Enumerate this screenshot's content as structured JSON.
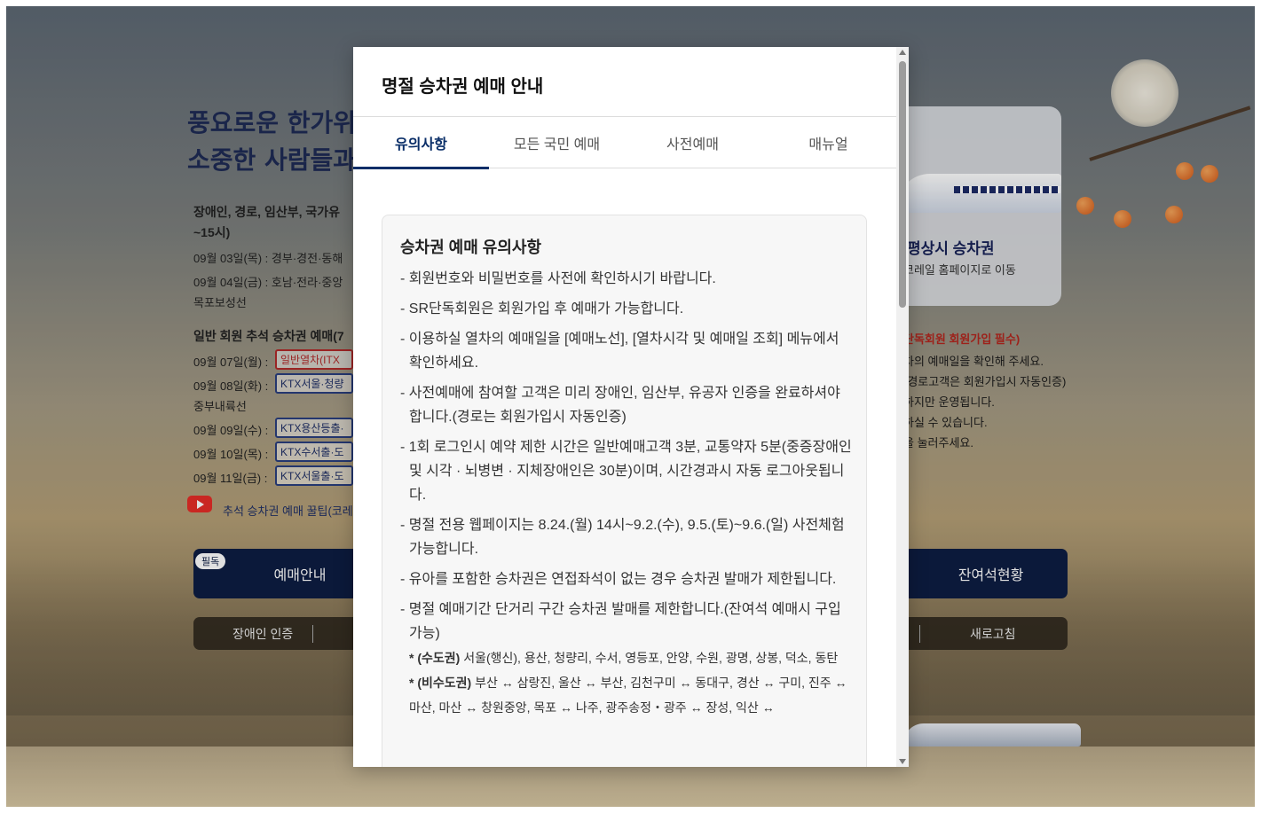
{
  "background": {
    "headline": "풍요로운 한가위\n소중한 사람들과",
    "intro": "장애인, 경로, 임산부, 국가유",
    "intro_time": "~15시)",
    "schedule_1": "09월 03일(목) : 경부·경전·동해",
    "schedule_2": "09월 04일(금) : 호남·전라·중앙",
    "schedule_2b": "목포보성선",
    "general_title": "일반 회원 추석 승차권 예매(7",
    "general_1_date": "09월 07일(월) :",
    "general_1_tag": "일반열차(ITX",
    "general_2_date": "09월 08일(화) :",
    "general_2_tag": "KTX서울·청량",
    "general_2b": "중부내륙선",
    "general_3_date": "09월 09일(수) :",
    "general_3_tag": "KTX용산등출·",
    "general_4_date": "09월 10일(목) :",
    "general_4_tag": "KTX수서출·도",
    "general_5_date": "09월 11일(금) :",
    "general_5_tag": "KTX서울출·도",
    "youtube_link": "추석 승차권 예매 꿀팁(코레",
    "card_title": "평상시 승차권",
    "card_sub": "코레일 홈페이지로 이동",
    "side_red": "단독회원 회원가입 필수)",
    "side_1": "차의 예매일을 확인해 주세요.",
    "side_2": "(경로고객은 회원가입시 자동인증)",
    "side_3": "하지만 운영됩니다.",
    "side_4": "하실 수 있습니다.",
    "side_5": "을 눌러주세요.",
    "btn_booking_badge": "필독",
    "btn_booking": "예매안내",
    "btn_seats": "잔여석현황",
    "btn_disabled_auth": "장애인 인증",
    "btn_refresh": "새로고침"
  },
  "modal": {
    "title": "명절 승차권 예매 안내",
    "tabs": [
      {
        "label": "유의사항",
        "active": true
      },
      {
        "label": "모든 국민 예매",
        "active": false
      },
      {
        "label": "사전예매",
        "active": false
      },
      {
        "label": "매뉴얼",
        "active": false
      }
    ],
    "notice": {
      "title": "승차권 예매 유의사항",
      "items": [
        "- 회원번호와 비밀번호를 사전에 확인하시기 바랍니다.",
        "- SR단독회원은 회원가입 후 예매가 가능합니다.",
        "- 이용하실 열차의 예매일을 [예매노선], [열차시각 및 예매일 조회] 메뉴에서 확인하세요.",
        "- 사전예매에 참여할 고객은 미리 장애인, 임산부, 유공자 인증을 완료하셔야 합니다.(경로는 회원가입시 자동인증)",
        "- 1회 로그인시 예약 제한 시간은 일반예매고객 3분, 교통약자 5분(중증장애인 및 시각 · 뇌병변 · 지체장애인은 30분)이며, 시간경과시 자동 로그아웃됩니다.",
        "- 명절 전용 웹페이지는 8.24.(월) 14시~9.2.(수), 9.5.(토)~9.6.(일) 사전체험 가능합니다.",
        "- 유아를 포함한 승차권은 연접좌석이 없는 경우 승차권 발매가 제한됩니다.",
        "- 명절 예매기간 단거리 구간 승차권 발매를 제한합니다.(잔여석 예매시 구입가능)"
      ],
      "sub_1_label": "* (수도권)",
      "sub_1_text": " 서울(행신), 용산, 청량리, 수서, 영등포, 안양, 수원, 광명, 상봉, 덕소, 동탄",
      "sub_2_label": "* (비수도권)",
      "sub_2_text": " 부산 ↔ 삼랑진, 울산 ↔ 부산, 김천구미 ↔ 동대구, 경산 ↔ 구미, 진주 ↔ 마산, 마산 ↔ 창원중앙, 목포 ↔ 나주, 광주송정・광주 ↔ 장성, 익산 ↔"
    }
  },
  "colors": {
    "accent": "#0a2e68",
    "dark_button": "#0d1d43",
    "red_tag": "#b02a2a"
  }
}
